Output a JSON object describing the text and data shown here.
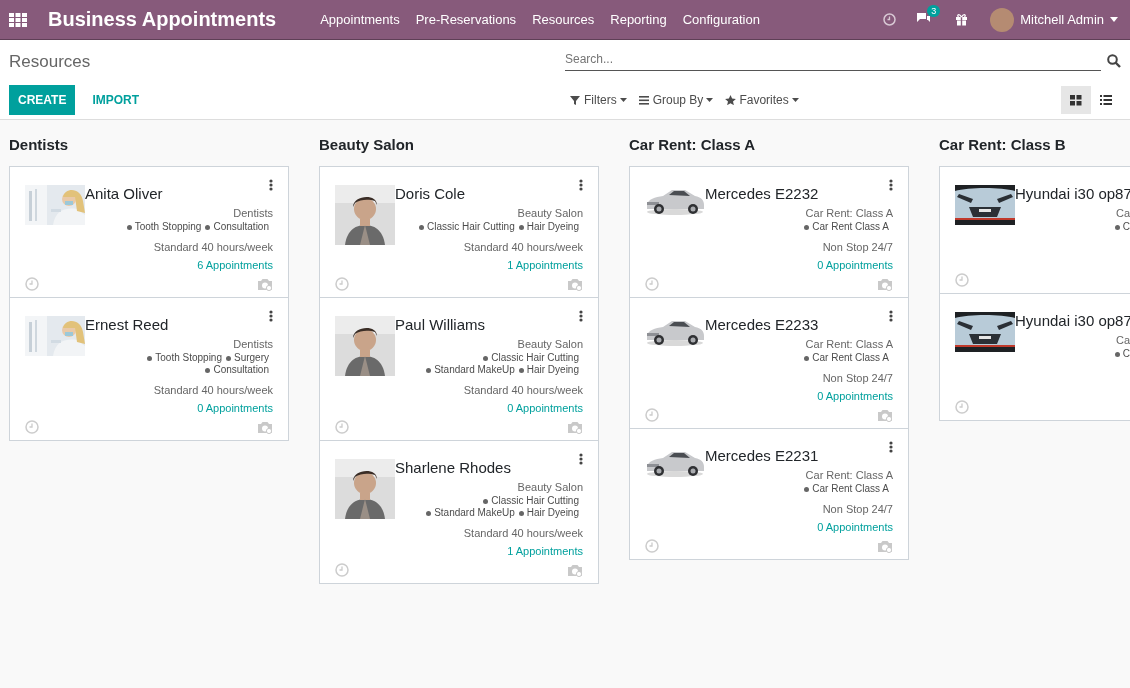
{
  "navbar": {
    "app_title": "Business Appointments",
    "menu": [
      "Appointments",
      "Pre-Reservations",
      "Resources",
      "Reporting",
      "Configuration"
    ],
    "message_count": "3",
    "user": "Mitchell Admin"
  },
  "control_panel": {
    "breadcrumb": "Resources",
    "search": {
      "placeholder": "Search..."
    },
    "buttons": [
      "CREATE",
      "IMPORT"
    ],
    "filters": [
      "Filters",
      "Group By",
      "Favorites"
    ],
    "views": [
      {
        "kind": "kanban",
        "selected": true
      },
      {
        "kind": "list",
        "selected": false
      }
    ]
  },
  "groups": [
    {
      "title": "Dentists",
      "cards": [
        {
          "name": "Anita Oliver",
          "image": {
            "kind": "picture"
          },
          "category": "Dentists",
          "tag_rows": [
            [
              "Tooth Stopping",
              "Consultation"
            ]
          ],
          "schedule": "Standard 40 hours/week",
          "appointments": "6 Appointments"
        },
        {
          "name": "Ernest Reed",
          "image": {
            "kind": "picture"
          },
          "category": "Dentists",
          "tag_rows": [
            [
              "Tooth Stopping",
              "Surgery"
            ],
            [
              "Consultation"
            ]
          ],
          "schedule": "Standard 40 hours/week",
          "appointments": "0 Appointments"
        }
      ]
    },
    {
      "title": "Beauty Salon",
      "cards": [
        {
          "name": "Doris Cole",
          "image": {
            "kind": "picture"
          },
          "category": "Beauty Salon",
          "tag_rows": [
            [
              "Classic Hair Cutting",
              "Hair Dyeing"
            ]
          ],
          "schedule": "Standard 40 hours/week",
          "appointments": "1 Appointments"
        },
        {
          "name": "Paul Williams",
          "image": {
            "kind": "picture"
          },
          "category": "Beauty Salon",
          "tag_rows": [
            [
              "Classic Hair Cutting"
            ],
            [
              "Standard MakeUp",
              "Hair Dyeing"
            ]
          ],
          "schedule": "Standard 40 hours/week",
          "appointments": "0 Appointments"
        },
        {
          "name": "Sharlene Rhodes",
          "image": {
            "kind": "picture"
          },
          "category": "Beauty Salon",
          "tag_rows": [
            [
              "Classic Hair Cutting"
            ],
            [
              "Standard MakeUp",
              "Hair Dyeing"
            ]
          ],
          "schedule": "Standard 40 hours/week",
          "appointments": "1 Appointments"
        }
      ]
    },
    {
      "title": "Car Rent: Class A",
      "cards": [
        {
          "name": "Mercedes E2232",
          "image": {
            "kind": "picture"
          },
          "category": "Car Rent: Class A",
          "tag_rows": [
            [
              "Car Rent Class A"
            ]
          ],
          "schedule": "Non Stop 24/7",
          "appointments": "0 Appointments"
        },
        {
          "name": "Mercedes E2233",
          "image": {
            "kind": "picture"
          },
          "category": "Car Rent: Class A",
          "tag_rows": [
            [
              "Car Rent Class A"
            ]
          ],
          "schedule": "Non Stop 24/7",
          "appointments": "0 Appointments"
        },
        {
          "name": "Mercedes E2231",
          "image": {
            "kind": "picture"
          },
          "category": "Car Rent: Class A",
          "tag_rows": [
            [
              "Car Rent Class A"
            ]
          ],
          "schedule": "Non Stop 24/7",
          "appointments": "0 Appointments"
        }
      ]
    },
    {
      "title": "Car Rent: Class B",
      "cards": [
        {
          "name": "Hyundai i30 op87",
          "image": {
            "kind": "picture"
          },
          "category": "Ca",
          "tag_rows": [
            [
              "C"
            ]
          ]
        },
        {
          "name": "Hyundai i30 op87",
          "image": {
            "kind": "picture"
          },
          "category": "Ca",
          "tag_rows": [
            [
              "C"
            ]
          ]
        }
      ]
    }
  ]
}
